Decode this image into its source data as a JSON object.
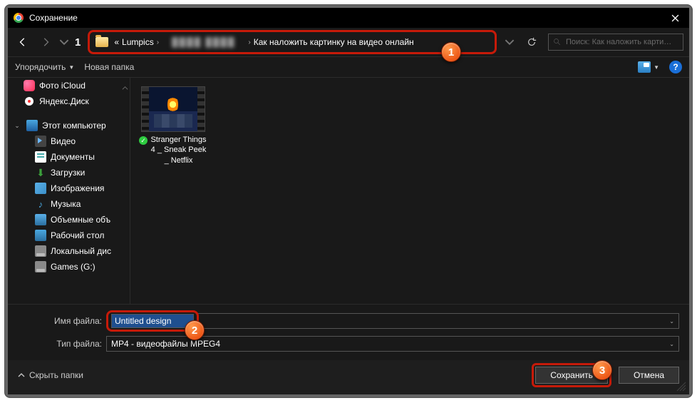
{
  "title": "Сохранение",
  "breadcrumb": {
    "prefix": "«",
    "seg1": "Lumpics",
    "seg_blur": "████ ████",
    "seg_last": "Как наложить картинку на видео онлайн"
  },
  "search": {
    "placeholder": "Поиск: Как наложить карти…"
  },
  "toolbar": {
    "organize": "Упорядочить",
    "new_folder": "Новая папка"
  },
  "sidebar": {
    "items": [
      {
        "label": "Фото iCloud",
        "cls": "ico-cloud"
      },
      {
        "label": "Яндекс.Диск",
        "cls": "ico-yd"
      },
      {
        "label": "Этот компьютер",
        "cls": "ico-pc",
        "top": true
      },
      {
        "label": "Видео",
        "cls": "ico-vid",
        "l2": true
      },
      {
        "label": "Документы",
        "cls": "ico-doc",
        "l2": true
      },
      {
        "label": "Загрузки",
        "cls": "ico-dl",
        "l2": true,
        "glyph": "↓"
      },
      {
        "label": "Изображения",
        "cls": "ico-img",
        "l2": true
      },
      {
        "label": "Музыка",
        "cls": "ico-mus",
        "l2": true,
        "glyph": "♪"
      },
      {
        "label": "Объемные объ",
        "cls": "ico-3d",
        "l2": true
      },
      {
        "label": "Рабочий стол",
        "cls": "ico-desk",
        "l2": true
      },
      {
        "label": "Локальный дис",
        "cls": "ico-disk",
        "l2": true
      },
      {
        "label": "Games (G:)",
        "cls": "ico-disk",
        "l2": true
      }
    ]
  },
  "file_item": {
    "name": "Stranger Things 4 _ Sneak Peek _ Netflix"
  },
  "filename": {
    "label": "Имя файла:",
    "value": "Untitled design"
  },
  "filetype": {
    "label": "Тип файла:",
    "value": "MP4 - видеофайлы MPEG4"
  },
  "hide_folders": "Скрыть папки",
  "save_btn": "Сохранить",
  "cancel_btn": "Отмена",
  "markers": {
    "m1": "1",
    "m2": "2",
    "m3": "3"
  },
  "nav_up_fragment": "1"
}
